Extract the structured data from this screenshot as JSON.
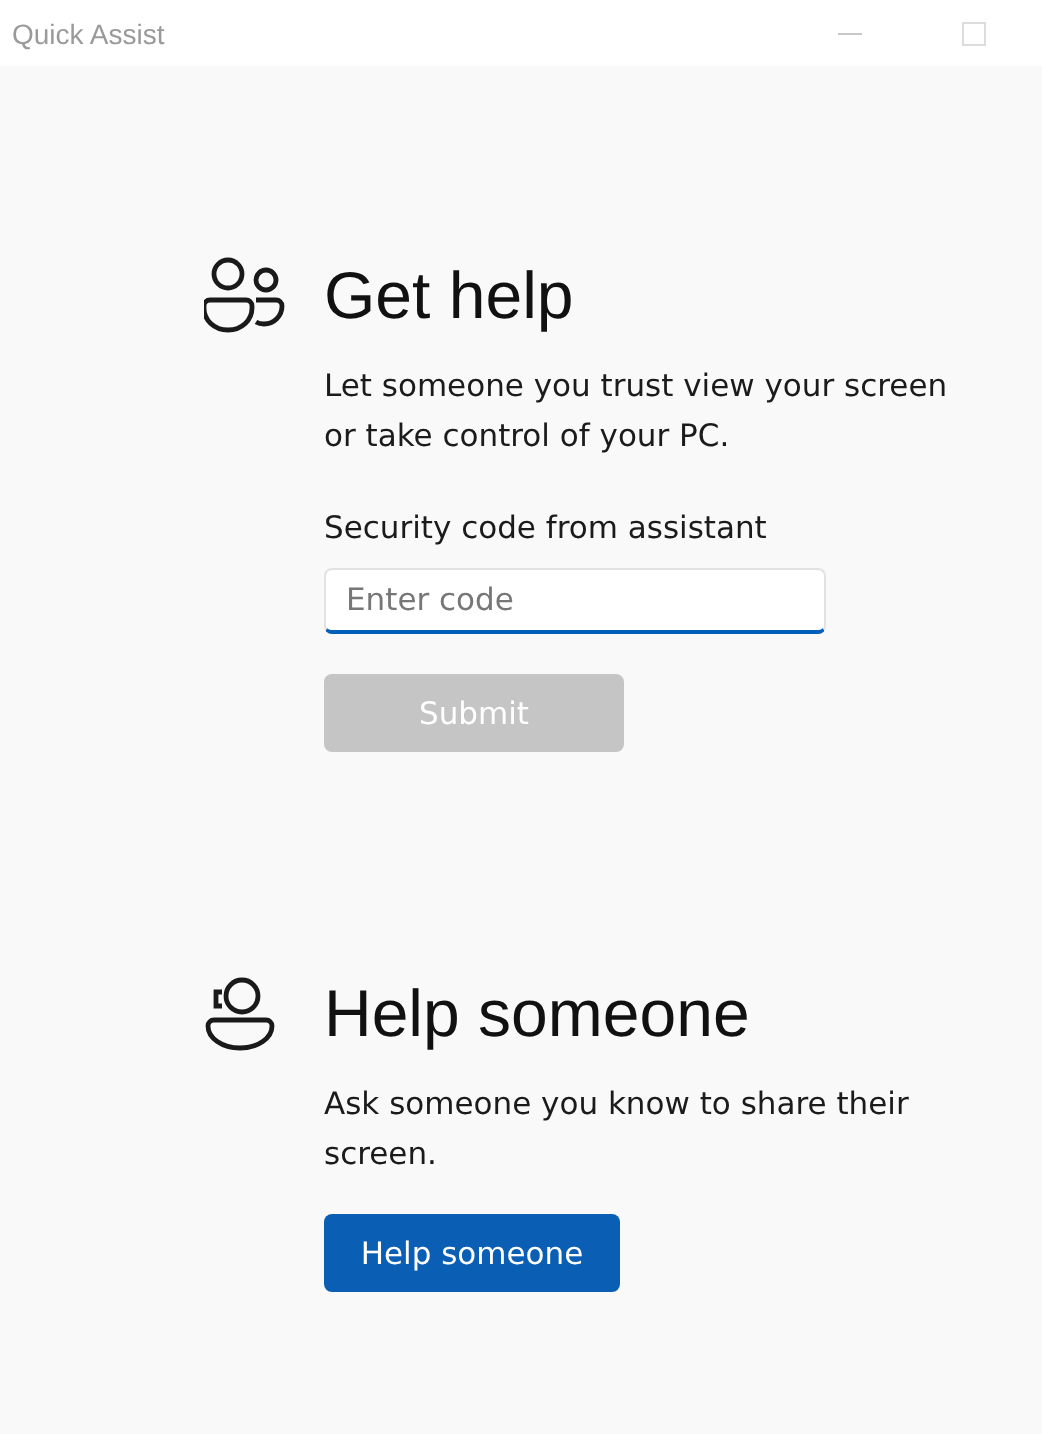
{
  "window": {
    "title": "Quick Assist"
  },
  "sections": [
    {
      "kind": "get_help",
      "heading": "Get help",
      "description": "Let someone you trust view your screen or take control of your PC.",
      "field_label": "Security code from assistant",
      "field": {
        "placeholder": "Enter code"
      },
      "button": {
        "label": "Submit",
        "disabled": true
      }
    },
    {
      "kind": "help_someone",
      "heading": "Help someone",
      "description": "Ask someone you know to share their screen.",
      "button": {
        "label": "Help someone",
        "disabled": false
      }
    }
  ]
}
